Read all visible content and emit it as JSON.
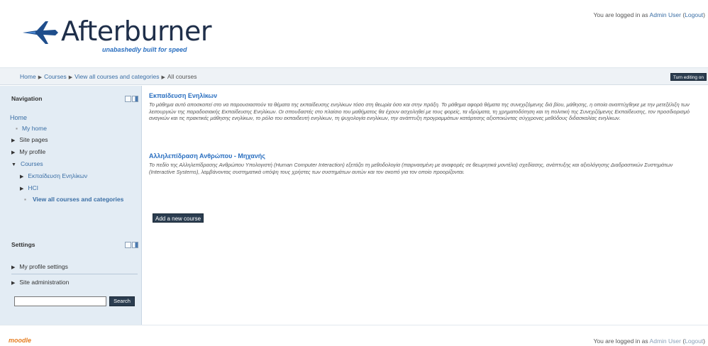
{
  "header": {
    "logo_text": "Afterburner",
    "logo_tagline": "unabashedly built for speed",
    "login_prefix": "You are logged in as ",
    "user_name": "Admin User",
    "logout_open": " (",
    "logout_label": "Logout",
    "logout_close": ")"
  },
  "navbar": {
    "breadcrumb": [
      "Home",
      "Courses",
      "View all courses and categories",
      "All courses"
    ],
    "turn_editing_label": "Turn editing on"
  },
  "navigation": {
    "title": "Navigation",
    "home_label": "Home",
    "items": [
      {
        "label": "My home"
      },
      {
        "label": "Site pages"
      },
      {
        "label": "My profile"
      },
      {
        "label": "Courses"
      },
      {
        "label": "Εκπαίδευση Ενηλίκων"
      },
      {
        "label": "HCI"
      },
      {
        "label": "View all courses and categories"
      }
    ]
  },
  "settings": {
    "title": "Settings",
    "items": [
      {
        "label": "My profile settings"
      },
      {
        "label": "Site administration"
      }
    ],
    "search_value": "",
    "search_button": "Search"
  },
  "courses": [
    {
      "title": "Εκπαίδευση Ενηλίκων",
      "summary": "Το μάθημα αυτό αποσκοπεί στο να παρουσιαστούν τα θέματα της εκπαίδευσης ενηλίκων τόσο στη θεωρία όσο και στην πράξη. Το μάθημα αφορά θέματα της συνεχιζόμενης διά βίου, μάθησης, η οποία αναπτύχθηκε με την μετεξέλιξη των λειτουργιών της παραδοσιακής Εκπαίδευσης Ενηλίκων. Οι σπουδαστές στο πλαίσιο του μαθήματος θα έχουν ασχοληθεί με τους φορείς, τα ιδρύματα, τη χρηματοδότηση και τη πολιτική της Συνεχιζόμενης Εκπαίδευσης, τον προσδιορισμό αναγκών και τις πρακτικές μάθησης ενηλίκων, το ρόλο του εκπαιδευτή ενηλίκων, τη ψυχολογία ενηλίκων, την ανάπτυξη προγραμμάτων κατάρτισης αξιοποιώντας σύγχρονες μεθόδους διδασκαλίας ενηλίκων."
    },
    {
      "title": "Αλληλεπίδραση Ανθρώπου - Μηχανής",
      "summary": "Το πεδίο της Αλληλεπίδρασης Ανθρώπου Υπολογιστή (Human Computer Interaction) εξετάζει τη μεθοδολογία (παιρνασμένη με αναφορές σε θεωρητικά μοντέλα) σχεδίασης, ανάπτυξης και αξιολόγησης Διαδραστικών Συστημάτων (Interactive Systems), λαμβάνοντας συστηματικά υπόψη τους χρήστες των συστημάτων αυτών και τον σκοπό για τον οποίο προορίζονται."
    }
  ],
  "add_course_label": "Add a new course",
  "footer": {
    "moodle_label": "moodle",
    "login_prefix": "You are logged in as ",
    "user_name": "Admin User",
    "logout_open": " (",
    "logout_label": "Logout",
    "logout_close": ")"
  },
  "colors": {
    "accent": "#2a6fc0",
    "sidebar_bg": "#e3ecf4",
    "button_bg": "#2b3d50"
  }
}
